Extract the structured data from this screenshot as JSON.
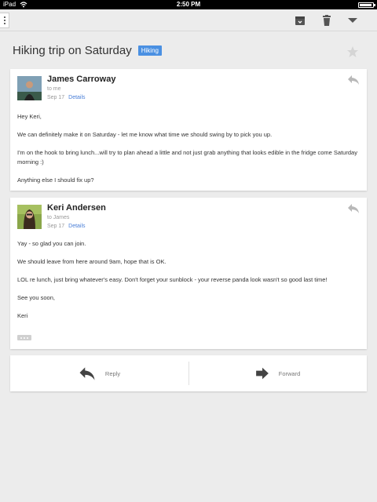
{
  "status_bar": {
    "carrier": "iPad",
    "time": "2:50 PM"
  },
  "toolbar": {
    "icons": [
      "menu-dots-icon",
      "archive-icon",
      "trash-icon",
      "more-icon"
    ]
  },
  "thread": {
    "subject": "Hiking trip on Saturday",
    "label": "Hiking",
    "label_color": "#4a90e2"
  },
  "messages": [
    {
      "sender": "James Carroway",
      "recipient": "to me",
      "date": "Sep 17",
      "details": "Details",
      "body": [
        "Hey Keri,",
        "We can definitely make it on Saturday - let me know what time we should swing by to pick you up.",
        "I'm on the hook to bring lunch...will try to plan ahead a little and not just grab anything that looks edible in the fridge come Saturday morning :)",
        "Anything else I should fix up?"
      ]
    },
    {
      "sender": "Keri Andersen",
      "recipient": "to James",
      "date": "Sep 17",
      "details": "Details",
      "body": [
        "Yay - so glad you can join.",
        "We should leave from here around 9am, hope that is OK.",
        "LOL re lunch, just bring whatever's easy. Don't forget your sunblock - your reverse panda look wasn't so good last time!",
        "See you soon,",
        "Keri"
      ]
    }
  ],
  "actions": {
    "reply": "Reply",
    "forward": "Forward"
  }
}
